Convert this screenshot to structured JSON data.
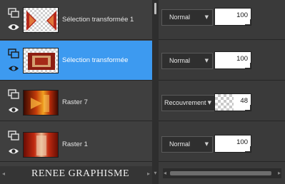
{
  "layers": [
    {
      "name": "Sélection transformée 1",
      "blend_mode": "Normal",
      "opacity": "100",
      "opacity_fraction": 1.0,
      "selected": false
    },
    {
      "name": "Sélection transformée",
      "blend_mode": "Normal",
      "opacity": "100",
      "opacity_fraction": 1.0,
      "selected": true
    },
    {
      "name": "Raster 7",
      "blend_mode": "Recouvrement",
      "opacity": "48",
      "opacity_fraction": 0.48,
      "selected": false
    },
    {
      "name": "Raster 1",
      "blend_mode": "Normal",
      "opacity": "100",
      "opacity_fraction": 1.0,
      "selected": false
    }
  ],
  "watermark": "RENEE GRAPHISME",
  "colors": {
    "selection": "#3d9af0",
    "panel": "#3f3f3f",
    "text": "#e4e4e4"
  },
  "icons": {
    "layer_type": "layer-group-icon",
    "visibility": "eye-icon",
    "dropdown": "chevron-down-icon"
  }
}
